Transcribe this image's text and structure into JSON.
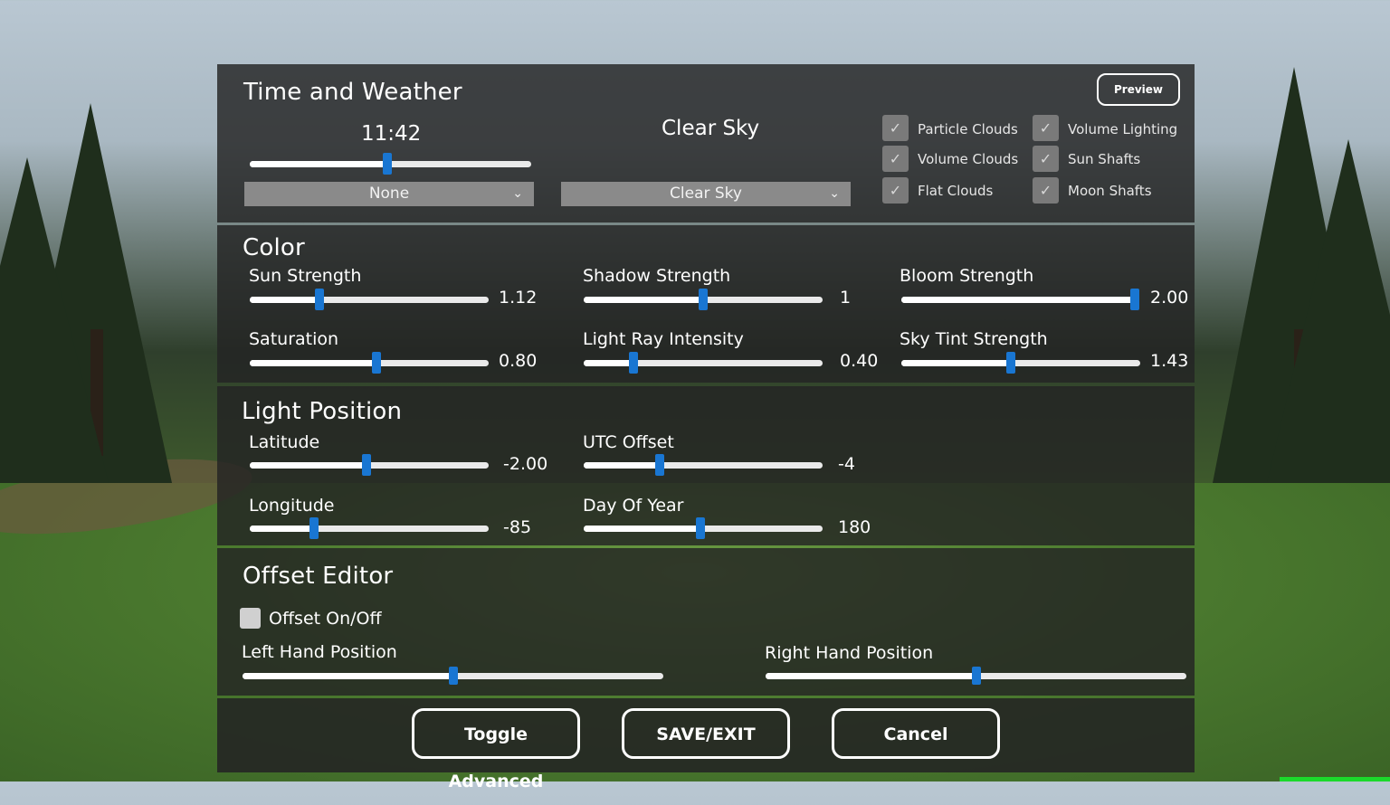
{
  "time_weather": {
    "title": "Time and Weather",
    "preview_label": "Preview",
    "time_value": "11:42",
    "time_fraction": 0.49,
    "time_preset": "None",
    "weather_title": "Clear Sky",
    "weather_preset": "Clear Sky",
    "options": [
      {
        "label": "Particle Clouds",
        "checked": true
      },
      {
        "label": "Volume Clouds",
        "checked": true
      },
      {
        "label": "Flat Clouds",
        "checked": true
      },
      {
        "label": "Volume Lighting",
        "checked": true
      },
      {
        "label": "Sun Shafts",
        "checked": true
      },
      {
        "label": "Moon Shafts",
        "checked": true
      }
    ]
  },
  "color": {
    "title": "Color",
    "sliders": [
      {
        "label": "Sun Strength",
        "value": "1.12",
        "fraction": 0.29
      },
      {
        "label": "Shadow Strength",
        "value": "1",
        "fraction": 0.5
      },
      {
        "label": "Bloom Strength",
        "value": "2.00",
        "fraction": 1.0
      },
      {
        "label": "Saturation",
        "value": "0.80",
        "fraction": 0.53
      },
      {
        "label": "Light Ray Intensity",
        "value": "0.40",
        "fraction": 0.21
      },
      {
        "label": "Sky Tint Strength",
        "value": "1.43",
        "fraction": 0.46
      }
    ]
  },
  "light_position": {
    "title": "Light Position",
    "sliders": [
      {
        "label": "Latitude",
        "value": "-2.00",
        "fraction": 0.49
      },
      {
        "label": "UTC Offset",
        "value": "-4",
        "fraction": 0.32
      },
      {
        "label": "Longitude",
        "value": "-85",
        "fraction": 0.27
      },
      {
        "label": "Day Of Year",
        "value": "180",
        "fraction": 0.49
      }
    ]
  },
  "offset_editor": {
    "title": "Offset Editor",
    "toggle_label": "Offset On/Off",
    "toggle_checked": false,
    "left_label": "Left Hand Position",
    "left_fraction": 0.5,
    "right_label": "Right Hand Position",
    "right_fraction": 0.5
  },
  "footer": {
    "toggle_advanced": "Toggle Advanced",
    "save_exit": "SAVE/EXIT",
    "cancel": "Cancel"
  },
  "colors": {
    "accent": "#1976d2",
    "panel": "#232323",
    "status_green": "#1bd92b"
  }
}
